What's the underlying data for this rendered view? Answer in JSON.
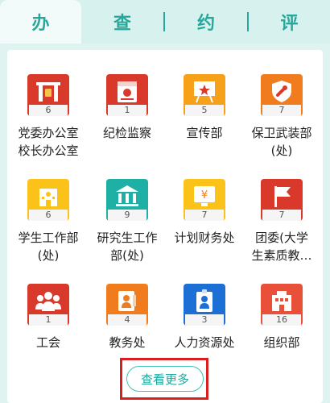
{
  "tabs": [
    {
      "label": "办",
      "active": true
    },
    {
      "label": "查",
      "active": false
    },
    {
      "label": "约",
      "active": false
    },
    {
      "label": "评",
      "active": false
    }
  ],
  "items": [
    {
      "label": "党委办公室\n校长办公室",
      "count": "6",
      "color": "#d8392b",
      "icon": "gate-icon"
    },
    {
      "label": "纪检监察",
      "count": "1",
      "color": "#d8392b",
      "icon": "party-calendar-icon"
    },
    {
      "label": "宣传部",
      "count": "5",
      "color": "#f7a11a",
      "icon": "star-board-icon"
    },
    {
      "label": "保卫武装部\n(处)",
      "count": "7",
      "color": "#f07c1e",
      "icon": "shield-wrench-icon"
    },
    {
      "label": "学生工作部\n(处)",
      "count": "6",
      "color": "#fbc21a",
      "icon": "school-icon"
    },
    {
      "label": "研究生工作\n部(处)",
      "count": "9",
      "color": "#1fb0a5",
      "icon": "institution-icon"
    },
    {
      "label": "计划财务处",
      "count": "7",
      "color": "#fbc21a",
      "icon": "yuan-screen-icon"
    },
    {
      "label": "团委(大学\n生素质教…",
      "count": "7",
      "color": "#d8392b",
      "icon": "flag-icon"
    },
    {
      "label": "工会",
      "count": "1",
      "color": "#d8392b",
      "icon": "people-icon"
    },
    {
      "label": "教务处",
      "count": "4",
      "color": "#f07c1e",
      "icon": "document-person-icon"
    },
    {
      "label": "人力资源处",
      "count": "3",
      "color": "#1c6fd4",
      "icon": "badge-icon"
    },
    {
      "label": "组织部",
      "count": "16",
      "color": "#e8503a",
      "icon": "building-icon"
    }
  ],
  "more_button": "查看更多"
}
